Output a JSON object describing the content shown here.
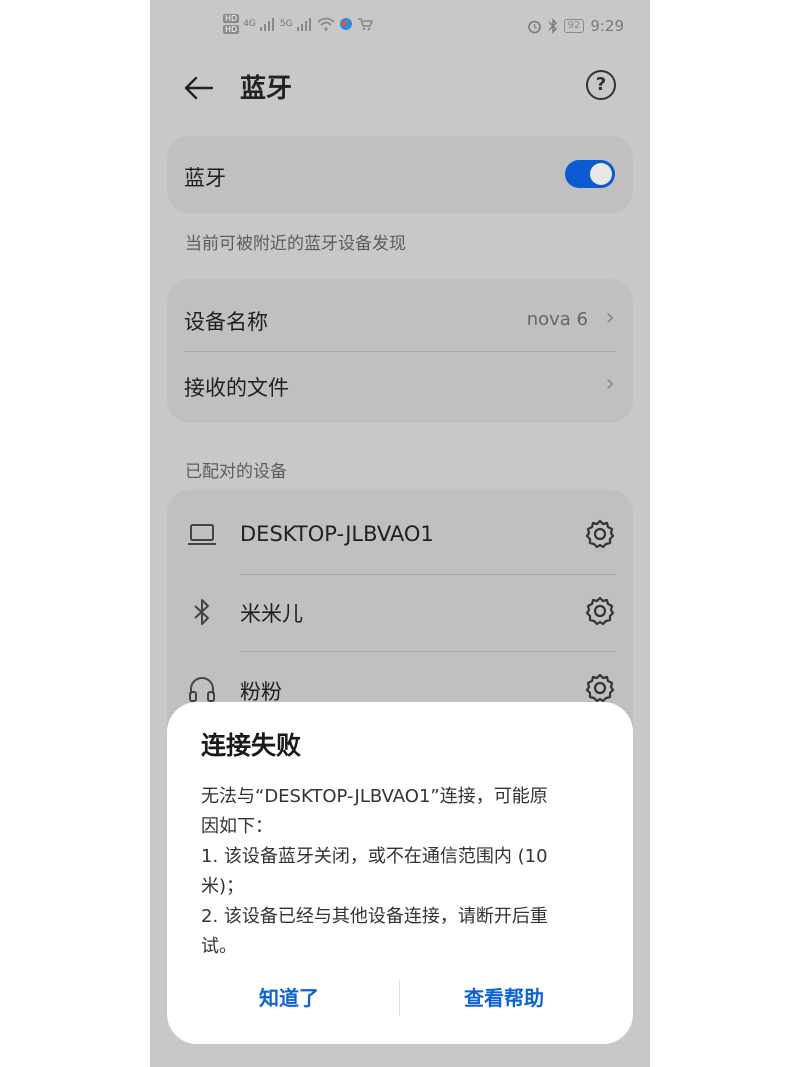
{
  "status_bar": {
    "hd_top": "HD",
    "hd_bottom": "HD",
    "sim1": "4G",
    "sim2": "5G",
    "battery": "92",
    "time": "9:29"
  },
  "header": {
    "title": "蓝牙",
    "help_symbol": "?"
  },
  "bluetooth_toggle": {
    "label": "蓝牙",
    "on": true,
    "caption": "当前可被附近的蓝牙设备发现"
  },
  "settings": {
    "device_name_label": "设备名称",
    "device_name_value": "nova 6",
    "received_files_label": "接收的文件"
  },
  "paired": {
    "section_title": "已配对的设备",
    "devices": [
      {
        "name": "DESKTOP-JLBVAO1",
        "icon": "laptop-icon"
      },
      {
        "name": "米米儿",
        "icon": "bluetooth-icon"
      },
      {
        "name": "粉粉",
        "icon": "headphones-icon"
      }
    ]
  },
  "dialog": {
    "title": "连接失败",
    "lines": [
      "无法与“DESKTOP-JLBVAO1”连接，可能原",
      "因如下：",
      "1. 该设备蓝牙关闭，或不在通信范围内 (10",
      "米)；",
      "2. 该设备已经与其他设备连接，请断开后重",
      "试。"
    ],
    "ok_label": "知道了",
    "help_label": "查看帮助"
  },
  "colors": {
    "accent": "#0a5bd0",
    "button_text": "#0b62d6"
  }
}
